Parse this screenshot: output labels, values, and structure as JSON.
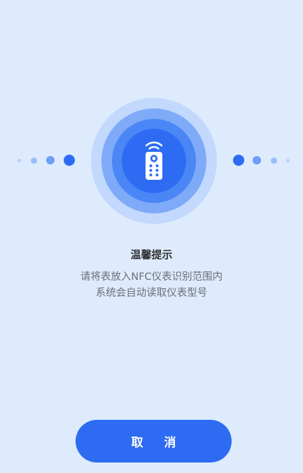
{
  "dialog": {
    "title": "温馨提示",
    "message_line1": "请将表放入NFC仪表识别范围内",
    "message_line2": "系统会自动读取仪表型号",
    "cancel_label": "取 消"
  },
  "icon": {
    "center": "nfc-remote-meter-icon"
  },
  "colors": {
    "background": "#DDEBFD",
    "accent": "#2D6CF2",
    "ring_outer": "#C2D8FC",
    "ring_middle": "#7EAAF8",
    "ring_inner": "#4A86F6",
    "dot_light": "#9CBEF9"
  }
}
